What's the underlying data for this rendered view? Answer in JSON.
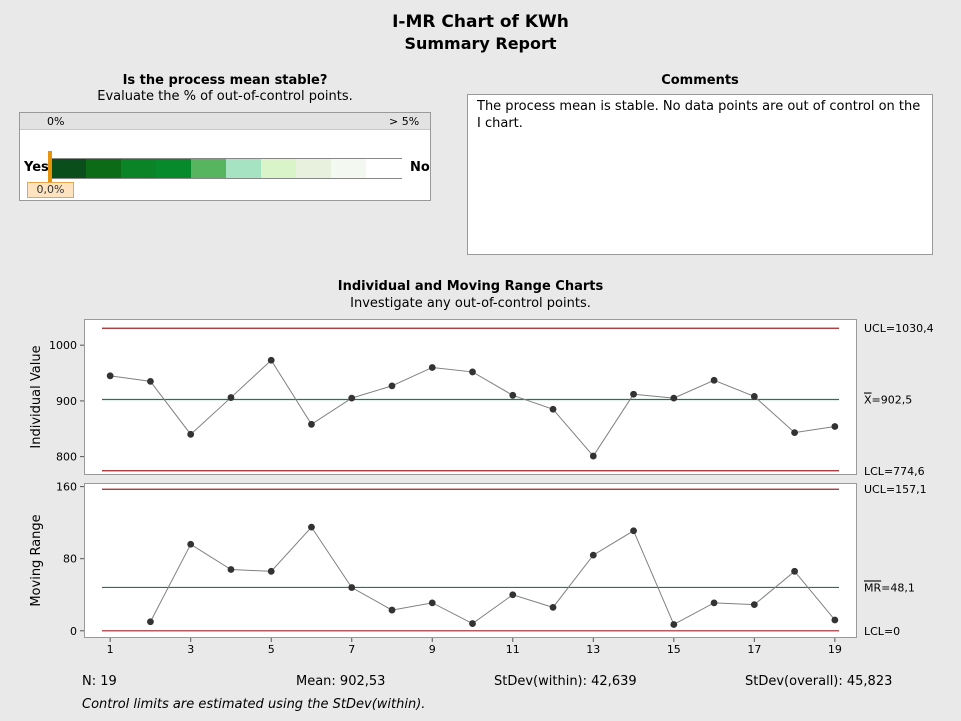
{
  "report": {
    "title": "I-MR Chart of KWh",
    "subtitle": "Summary Report"
  },
  "stability": {
    "question": "Is the process mean stable?",
    "instruction": "Evaluate the % of out-of-control points.",
    "scale_min_label": "0%",
    "scale_max_label": "> 5%",
    "yes_label": "Yes",
    "no_label": "No",
    "value_label": "0,0%",
    "value_percent": 0,
    "segment_colors": [
      "#0a4e1c",
      "#0b6b16",
      "#0b8427",
      "#078a2c",
      "#57b55f",
      "#a6e3c2",
      "#d9f4c8",
      "#e8f1dd",
      "#f3f8f1",
      "#ffffff"
    ]
  },
  "comments": {
    "title": "Comments",
    "text": "The process mean is stable. No data points are out of control on the I chart."
  },
  "charts_section": {
    "title": "Individual and Moving Range Charts",
    "instruction": "Investigate any out-of-control points."
  },
  "chart_data": [
    {
      "type": "line",
      "name": "individual",
      "ylabel": "Individual Value",
      "x": [
        1,
        2,
        3,
        4,
        5,
        6,
        7,
        8,
        9,
        10,
        11,
        12,
        13,
        14,
        15,
        16,
        17,
        18,
        19
      ],
      "values": [
        945,
        935,
        840,
        906,
        973,
        858,
        905,
        927,
        960,
        952,
        910,
        885,
        801,
        912,
        905,
        937,
        908,
        843,
        854
      ],
      "ylim": [
        767,
        1047
      ],
      "yticks": [
        800,
        900,
        1000
      ],
      "ytick_labels": [
        "800",
        "900",
        "1000"
      ],
      "limits": {
        "ucl": 1030.4,
        "ucl_label": "UCL=1030,4",
        "center": 902.5,
        "center_symbol": "X",
        "center_label": "=902,5",
        "lcl": 774.6,
        "lcl_label": "LCL=774,6"
      },
      "colors": {
        "limit": "#a0222a",
        "center": "#1f7a44",
        "line": "#808080",
        "point": "#333333"
      }
    },
    {
      "type": "line",
      "name": "moving-range",
      "ylabel": "Moving Range",
      "x": [
        2,
        3,
        4,
        5,
        6,
        7,
        8,
        9,
        10,
        11,
        12,
        13,
        14,
        15,
        16,
        17,
        18,
        19
      ],
      "values": [
        10,
        96,
        68,
        66,
        115,
        48,
        23,
        31,
        8,
        40,
        26,
        84,
        111,
        7,
        31,
        29,
        66,
        12
      ],
      "xticks": [
        1,
        3,
        5,
        7,
        9,
        11,
        13,
        15,
        17,
        19
      ],
      "xlim": [
        0.35,
        19.55
      ],
      "ylim": [
        -8,
        164
      ],
      "yticks": [
        0,
        80,
        160
      ],
      "ytick_labels": [
        "0",
        "80",
        "160"
      ],
      "limits": {
        "ucl": 157.1,
        "ucl_label": "UCL=157,1",
        "center": 48.1,
        "center_symbol": "MR",
        "center_label": "=48,1",
        "lcl": 0,
        "lcl_label": "LCL=0"
      },
      "colors": {
        "limit": "#a0222a",
        "center": "#1f7a44",
        "line": "#808080",
        "point": "#333333"
      }
    }
  ],
  "stats": {
    "n": "N: 19",
    "mean": "Mean: 902,53",
    "stdev_within": "StDev(within): 42,639",
    "stdev_overall": "StDev(overall): 45,823",
    "note": "Control limits are estimated using the StDev(within)."
  }
}
